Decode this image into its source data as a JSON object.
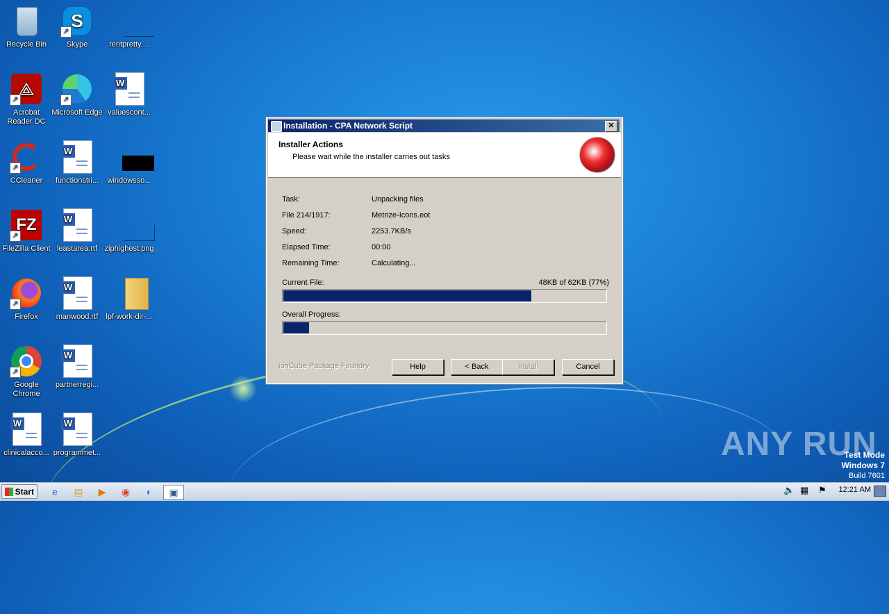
{
  "desktop": {
    "icons": [
      {
        "label": "Recycle Bin"
      },
      {
        "label": "Skype"
      },
      {
        "label": "rentpretty...."
      },
      {
        "label": "Acrobat Reader DC"
      },
      {
        "label": "Microsoft Edge"
      },
      {
        "label": "valuescont..."
      },
      {
        "label": "CCleaner"
      },
      {
        "label": "functionstri..."
      },
      {
        "label": "windowsso..."
      },
      {
        "label": "FileZilla Client"
      },
      {
        "label": "leastarea.rtf"
      },
      {
        "label": "ziphighest.png"
      },
      {
        "label": "Firefox"
      },
      {
        "label": "manwood.rtf"
      },
      {
        "label": "lpf-work-dir-..."
      },
      {
        "label": "Google Chrome"
      },
      {
        "label": "partnerregi..."
      },
      {
        "label": "clinicalacco..."
      },
      {
        "label": "programmet..."
      }
    ]
  },
  "dialog": {
    "title": "Installation - CPA Network Script",
    "close": "✕",
    "header_title": "Installer Actions",
    "header_subtitle": "Please wait while the installer carries out tasks",
    "rows": [
      {
        "label": "Task:",
        "value": "Unpacking files"
      },
      {
        "label": "File 214/1917:",
        "value": "Metrize-Icons.eot"
      },
      {
        "label": "Speed:",
        "value": "2253.7KB/s"
      },
      {
        "label": "Elapsed Time:",
        "value": "00:00"
      },
      {
        "label": "Remaining Time:",
        "value": "Calculating..."
      }
    ],
    "current_file_label": "Current File:",
    "current_file_status": "48KB of 62KB (77%)",
    "current_file_progress": 0.77,
    "overall_label": "Overall Progress:",
    "overall_progress": 0.08,
    "foundry": "ionCube Package Foundry",
    "buttons": {
      "help": "Help",
      "back": "< Back",
      "install": "Install",
      "cancel": "Cancel"
    }
  },
  "watermark": {
    "text": "ANY RUN"
  },
  "testmode": {
    "line1": "Test Mode",
    "line2": "Windows 7",
    "line3": "Build 7601"
  },
  "taskbar": {
    "start": "Start",
    "clock": "12:21 AM"
  }
}
